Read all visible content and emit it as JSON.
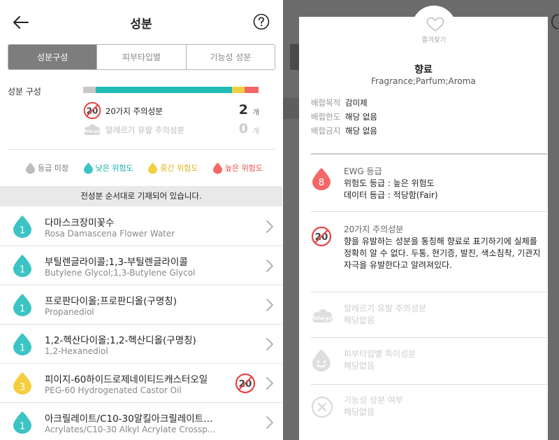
{
  "left": {
    "header": {
      "title": "성분"
    },
    "tabs": [
      {
        "label": "성분구성",
        "active": true
      },
      {
        "label": "피부타입별",
        "active": false
      },
      {
        "label": "기능성 성분",
        "active": false
      }
    ],
    "composition": {
      "label": "성분 구성",
      "bar": [
        {
          "fraction": 0.07,
          "color": "#c8c8c8"
        },
        {
          "fraction": 0.78,
          "color": "#1fbdb6"
        },
        {
          "fraction": 0.07,
          "color": "#f3cf3f"
        },
        {
          "fraction": 0.08,
          "color": "#f16866"
        }
      ],
      "caution20": {
        "label": "20가지 주의성분",
        "count": "2",
        "unit": "개"
      },
      "allergy": {
        "label": "알레르기 유발 주의성분",
        "count": "0",
        "unit": "개"
      }
    },
    "legend": [
      {
        "label": "등급 미정",
        "color": "#bdbdbd",
        "text_color": "#777777"
      },
      {
        "label": "낮은 위험도",
        "color": "#3cc4c4",
        "text_color": "#1aaeae"
      },
      {
        "label": "중간 위험도",
        "color": "#f3cf3f",
        "text_color": "#e0b114"
      },
      {
        "label": "높은 위험도",
        "color": "#f16866",
        "text_color": "#ee4d4b"
      }
    ],
    "notice": "전성분 순서대로 기재되어 있습니다.",
    "ingredients": [
      {
        "grade": "1",
        "color": "#3cc4c4",
        "name": "다마스크장미꽃수",
        "eng": "Rosa Damascena Flower Water",
        "caution20": false
      },
      {
        "grade": "1",
        "color": "#3cc4c4",
        "name": "부틸렌글라이콜;1,3-부틸렌글라이콜",
        "eng": "Butylene Glycol;1,3-Butylene Glycol",
        "caution20": false
      },
      {
        "grade": "1",
        "color": "#3cc4c4",
        "name": "프로판다이올;프로판디올(구명칭)",
        "eng": "Propanediol",
        "caution20": false
      },
      {
        "grade": "1",
        "color": "#3cc4c4",
        "name": "1,2-헥산다이올;1,2-헥산디올(구명칭)",
        "eng": "1,2-Hexanediol",
        "caution20": false
      },
      {
        "grade": "3",
        "color": "#f3cf3f",
        "name": "피이지-60하이드로제네이티드캐스터오일",
        "eng": "PEG-60 Hydrogenated Castor Oil",
        "caution20": true
      },
      {
        "grade": "1",
        "color": "#3cc4c4",
        "name": "아크릴레이트/C10-30알킬아크릴레이트…",
        "eng": "Acrylates/C10-30 Alkyl Acrylate Crossp...",
        "caution20": false
      }
    ]
  },
  "modal": {
    "favorite_label": "즐겨찾기",
    "name": "향료",
    "eng": "Fragrance;Parfum;Aroma",
    "info": [
      {
        "key": "배합목적",
        "value": "감미제"
      },
      {
        "key": "배합한도",
        "value": "해당 없음"
      },
      {
        "key": "배합금지",
        "value": "해당 없음"
      }
    ],
    "ewg": {
      "title": "EWG 등급",
      "grade": "8",
      "risk": "위험도 등급 : 높은 위험도",
      "data": "데이터 등급 : 적당함(Fair)"
    },
    "caution20": {
      "title": "20가지 주의성분",
      "desc": "향을 유발하는 성분을 통칭해 향료로 표기하기에 실체를 정확히 알 수 없다. 두통, 현기증, 발진, 색소침착, 기관지 자극을 유발한다고 알려져있다."
    },
    "allergy": {
      "title": "알레르기 유발 주의성분",
      "value": "해당없음",
      "icon_text": "Allergy"
    },
    "skin_type": {
      "title": "피부타입별 특이성분",
      "value": "해당없음"
    },
    "functional": {
      "title": "기능성 성분 여부",
      "value": "해당없음"
    }
  }
}
